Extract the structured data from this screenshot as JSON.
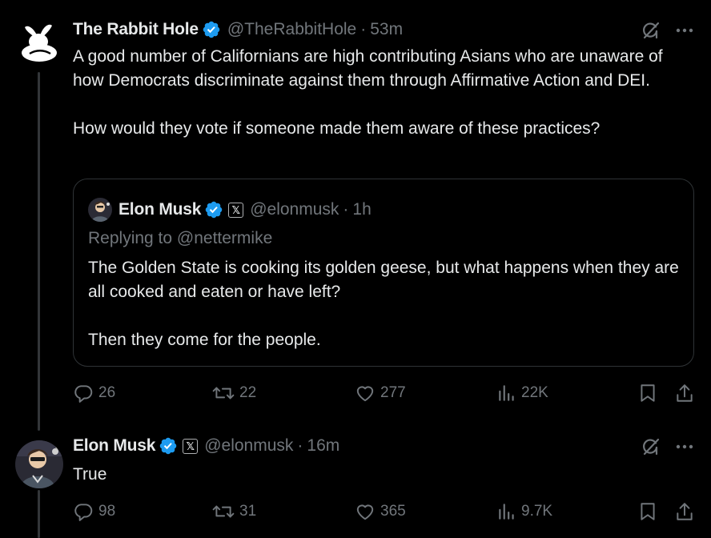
{
  "tweets": [
    {
      "display_name": "The Rabbit Hole",
      "handle": "@TheRabbitHole",
      "separator": "·",
      "time": "53m",
      "text": "A good number of Californians are high contributing Asians who are unaware of how Democrats discriminate against them through Affirmative Action and DEI.\n\nHow would they vote if someone made them aware of these practices?",
      "quote": {
        "display_name": "Elon Musk",
        "affiliate_badge": "𝕏",
        "handle": "@elonmusk",
        "separator": "·",
        "time": "1h",
        "replying_to": "Replying to @nettermike",
        "text": "The Golden State is cooking its golden geese, but what happens when they are all cooked and eaten or have left?\n\nThen they come for the people."
      },
      "stats": {
        "replies": "26",
        "reposts": "22",
        "likes": "277",
        "views": "22K"
      }
    },
    {
      "display_name": "Elon Musk",
      "affiliate_badge": "𝕏",
      "handle": "@elonmusk",
      "separator": "·",
      "time": "16m",
      "text": "True",
      "stats": {
        "replies": "98",
        "reposts": "31",
        "likes": "365",
        "views": "9.7K"
      }
    }
  ],
  "colors": {
    "background": "#000000",
    "text": "#e7e9ea",
    "muted": "#71767b",
    "verified": "#1d9bf0",
    "border": "#2f3336"
  },
  "icons": [
    "rabbit-logo-icon",
    "verified-icon",
    "x-badge-icon",
    "grok-icon",
    "more-icon",
    "reply-icon",
    "repost-icon",
    "like-icon",
    "views-icon",
    "bookmark-icon",
    "share-icon"
  ]
}
